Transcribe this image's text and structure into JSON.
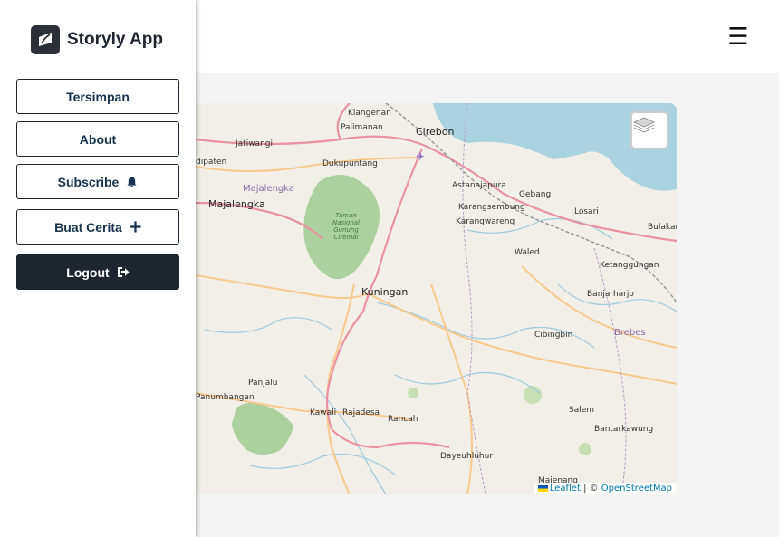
{
  "app": {
    "title": "Storyly App"
  },
  "header": {
    "menu_icon": "hamburger-icon",
    "menu_glyph": "☰"
  },
  "nav": {
    "saved": "Tersimpan",
    "about": "About",
    "subscribe": "Subscribe",
    "create_story": "Buat Cerita",
    "logout": "Logout"
  },
  "map": {
    "places": {
      "klangenan": "Klangenan",
      "palimanan": "Palimanan",
      "cirebon": "Cirebon",
      "jatiwangi": "Jatiwangi",
      "dipaten": "dipaten",
      "dukupuntang": "Dukupuntang",
      "majalengka_region": "Majalengka",
      "majalengka": "Majalengka",
      "astanajapura": "Astanajapura",
      "gebang": "Gebang",
      "karangsembung": "Karangsembung",
      "karangwareng": "Karangwareng",
      "losari": "Losari",
      "bulakamba": "Bulakam",
      "waled": "Waled",
      "ketanggungan": "Ketanggungan",
      "kuningan": "Kuningan",
      "banjarharjo": "Banjarharjo",
      "brebes": "Brebes",
      "cibingbin": "Cibingbin",
      "panjalu": "Panjalu",
      "panumbangan": "Panumbangan",
      "kawali": "Kawali",
      "rajadesa": "Rajadesa",
      "rancah": "Rancah",
      "salem": "Salem",
      "bantarkawung": "Bantarkawung",
      "dayeuhluhur": "Dayeuhluhur",
      "majenang": "Majenang",
      "park_line1": "Taman",
      "park_line2": "Nasional",
      "park_line3": "Gunung",
      "park_line4": "Ciremai"
    },
    "attribution": {
      "leaflet": "Leaflet",
      "separator": " | © ",
      "osm": "OpenStreetMap"
    }
  },
  "colors": {
    "sea": "#aad3df",
    "land": "#f2efe9",
    "forest": "#add19e",
    "road_main": "#e892a2",
    "road_secondary": "#f7c98d",
    "river": "#9ccbe0",
    "logout_bg": "#1d262e"
  }
}
